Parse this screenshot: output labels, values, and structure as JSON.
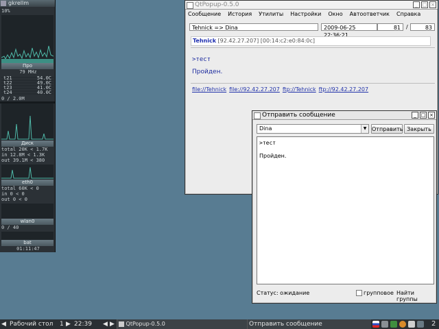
{
  "gkrellm": {
    "title": "gkrellm",
    "cpu_top_line": "10%",
    "cpu_label": "Про",
    "cpu_freq": "79 MHz",
    "temps": [
      {
        "name": "t21",
        "value": "54.0C"
      },
      {
        "name": "t22",
        "value": "49.0C"
      },
      {
        "name": "t23",
        "value": "41.0C"
      },
      {
        "name": "t24",
        "value": "40.0C"
      }
    ],
    "mem_line": "0 / 2.0M",
    "disk_label": "Диск",
    "disk_lines": [
      "total 20K < 1.7K",
      "in 12.8M < 1.3K",
      "out 39.1M < 380"
    ],
    "eth_label": "eth0",
    "eth_lines": [
      "total 60K < 0",
      "in 0 < 0",
      "out 0 < 0"
    ],
    "wlan_label": "wlan0",
    "wlan_line": "0 / 40",
    "bottom_label": "bat",
    "bottom_value": "01:11:47"
  },
  "main_window": {
    "title": "QtPopup-0.5.0",
    "menu": [
      "Сообщение",
      "История",
      "Утилиты",
      "Настройки",
      "Окно",
      "Автоответчик",
      "Справка"
    ],
    "header_route": "Tehnick => Dina",
    "header_datetime": "2009-06-25 22:36:21",
    "counter_current": "81",
    "counter_sep": "/",
    "counter_total": "83",
    "sender_nick": "Tehnick",
    "sender_info": " [92.42.27.207] [00:14:c2:e0:84:0c]",
    "message_line1": ">тест",
    "message_line2": "Пройден.",
    "links": [
      "file://Tehnick",
      "file://92.42.27.207",
      "ftp://Tehnick",
      "ftp://92.42.27.207"
    ]
  },
  "send_dialog": {
    "title": "Отправить сообщение",
    "recipient": "Dina",
    "send_label": "Отправить",
    "close_label": "Закрыть",
    "text_line1": ">тест",
    "text_line2": "Пройден.",
    "status": "Статус: ожидание",
    "group_label": "групповое",
    "find_groups_label": "Найти группы"
  },
  "taskbar": {
    "desktop_label": "Рабочий стол",
    "desktop_number": "1",
    "clock": "22:39",
    "tasks": [
      "QtPopup-0.5.0",
      "Отправить сообщение"
    ],
    "tray_number": "2"
  },
  "colors": {
    "desktop": "#587c92",
    "link": "#2233aa",
    "nick": "#1f2fb0"
  }
}
